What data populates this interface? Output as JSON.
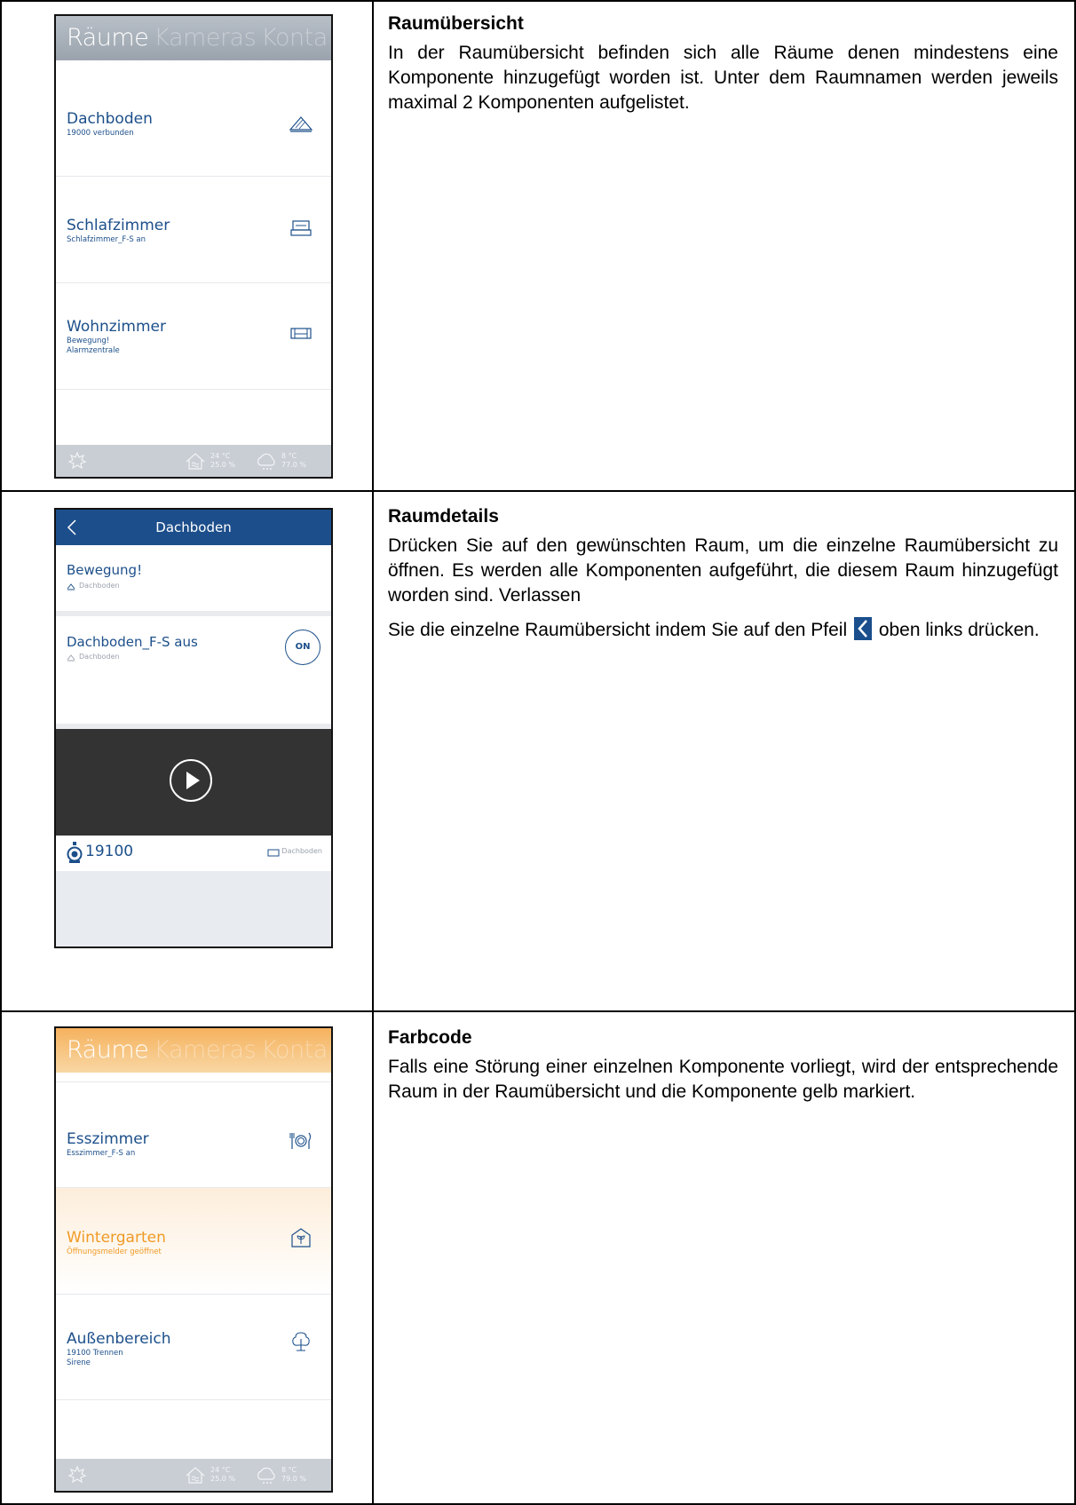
{
  "sections": [
    {
      "title": "Raumübersicht",
      "paragraphs": [
        "In der Raumübersicht befinden sich alle Räume denen mindestens eine Komponente hinzugefügt worden ist. Unter dem Raumnamen werden jeweils maximal 2 Komponenten aufgelistet."
      ]
    },
    {
      "title": "Raumdetails",
      "paragraph1": "Drücken Sie auf den gewünschten Raum, um die einzelne Raumübersicht zu öffnen. Es werden alle Komponenten aufgeführt, die diesem Raum hinzugefügt worden sind. Verlassen",
      "paragraph2_before": "Sie die einzelne Raumübersicht indem Sie auf den Pfeil",
      "paragraph2_after": "oben links drücken."
    },
    {
      "title": "Farbcode",
      "paragraphs": [
        "Falls eine Störung einer einzelnen Komponente vorliegt, wird der entsprechende Raum in der Raumübersicht und die Komponente gelb markiert."
      ]
    }
  ],
  "screen1": {
    "tabs": [
      "Räume",
      "Kameras",
      "Kontak"
    ],
    "rooms": [
      {
        "name": "Dachboden",
        "sub": [
          "19000 verbunden"
        ],
        "icon": "attic-icon"
      },
      {
        "name": "Schlafzimmer",
        "sub": [
          "Schlafzimmer_F-S an"
        ],
        "icon": "bed-icon"
      },
      {
        "name": "Wohnzimmer",
        "sub": [
          "Bewegung!",
          "Alarmzentrale"
        ],
        "icon": "sofa-icon"
      }
    ],
    "footer": {
      "indoor_temp": "24 °C",
      "indoor_hum": "25.0 %",
      "outdoor_temp": "8 °C",
      "outdoor_hum": "77.0 %"
    }
  },
  "screen2": {
    "title": "Dachboden",
    "components": [
      {
        "name": "Bewegung!",
        "room": "Dachboden"
      },
      {
        "name": "Dachboden_F-S aus",
        "room": "Dachboden",
        "button": "ON"
      }
    ],
    "camera": {
      "name": "19100",
      "room": "Dachboden"
    }
  },
  "screen3": {
    "tabs": [
      "Räume",
      "Kameras",
      "Kontak"
    ],
    "rooms": [
      {
        "name": "Esszimmer",
        "sub": [
          "Esszimmer_F-S an"
        ],
        "icon": "dining-icon"
      },
      {
        "name": "Wintergarten",
        "sub": [
          "Öffnungsmelder geöffnet"
        ],
        "icon": "plant-house-icon",
        "warning": true
      },
      {
        "name": "Außenbereich",
        "sub": [
          "19100 Trennen",
          "Sirene"
        ],
        "icon": "tree-icon"
      }
    ],
    "footer": {
      "indoor_temp": "24 °C",
      "indoor_hum": "25.0 %",
      "outdoor_temp": "8 °C",
      "outdoor_hum": "79.0 %"
    }
  },
  "colors": {
    "brand_blue": "#1c4f8a",
    "warning_orange": "#f09a26",
    "footer_grey": "#c9ced4"
  }
}
